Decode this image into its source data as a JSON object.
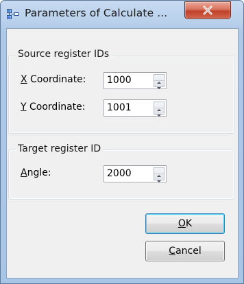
{
  "window": {
    "title": "Parameters of Calculate ...",
    "close_label": "X"
  },
  "source_group": {
    "caption": "Source register IDs",
    "x_label_mnemonic": "X",
    "x_label_rest": " Coordinate:",
    "x_value": "1000",
    "y_label_mnemonic": "Y",
    "y_label_rest": " Coordinate:",
    "y_value": "1001"
  },
  "target_group": {
    "caption": "Target register ID",
    "angle_label_mnemonic": "A",
    "angle_label_rest": "ngle:",
    "angle_value": "2000"
  },
  "buttons": {
    "ok_mnemonic": "O",
    "ok_rest": "K",
    "cancel_mnemonic": "C",
    "cancel_rest": "ancel"
  },
  "icons": {
    "app": "dialog-app-icon",
    "close": "close-icon",
    "spin": "up-down-arrows-icon"
  },
  "colors": {
    "titlebar": "#b9d1ec",
    "close_button": "#c7503a",
    "default_button_border": "#3c7fb1"
  }
}
